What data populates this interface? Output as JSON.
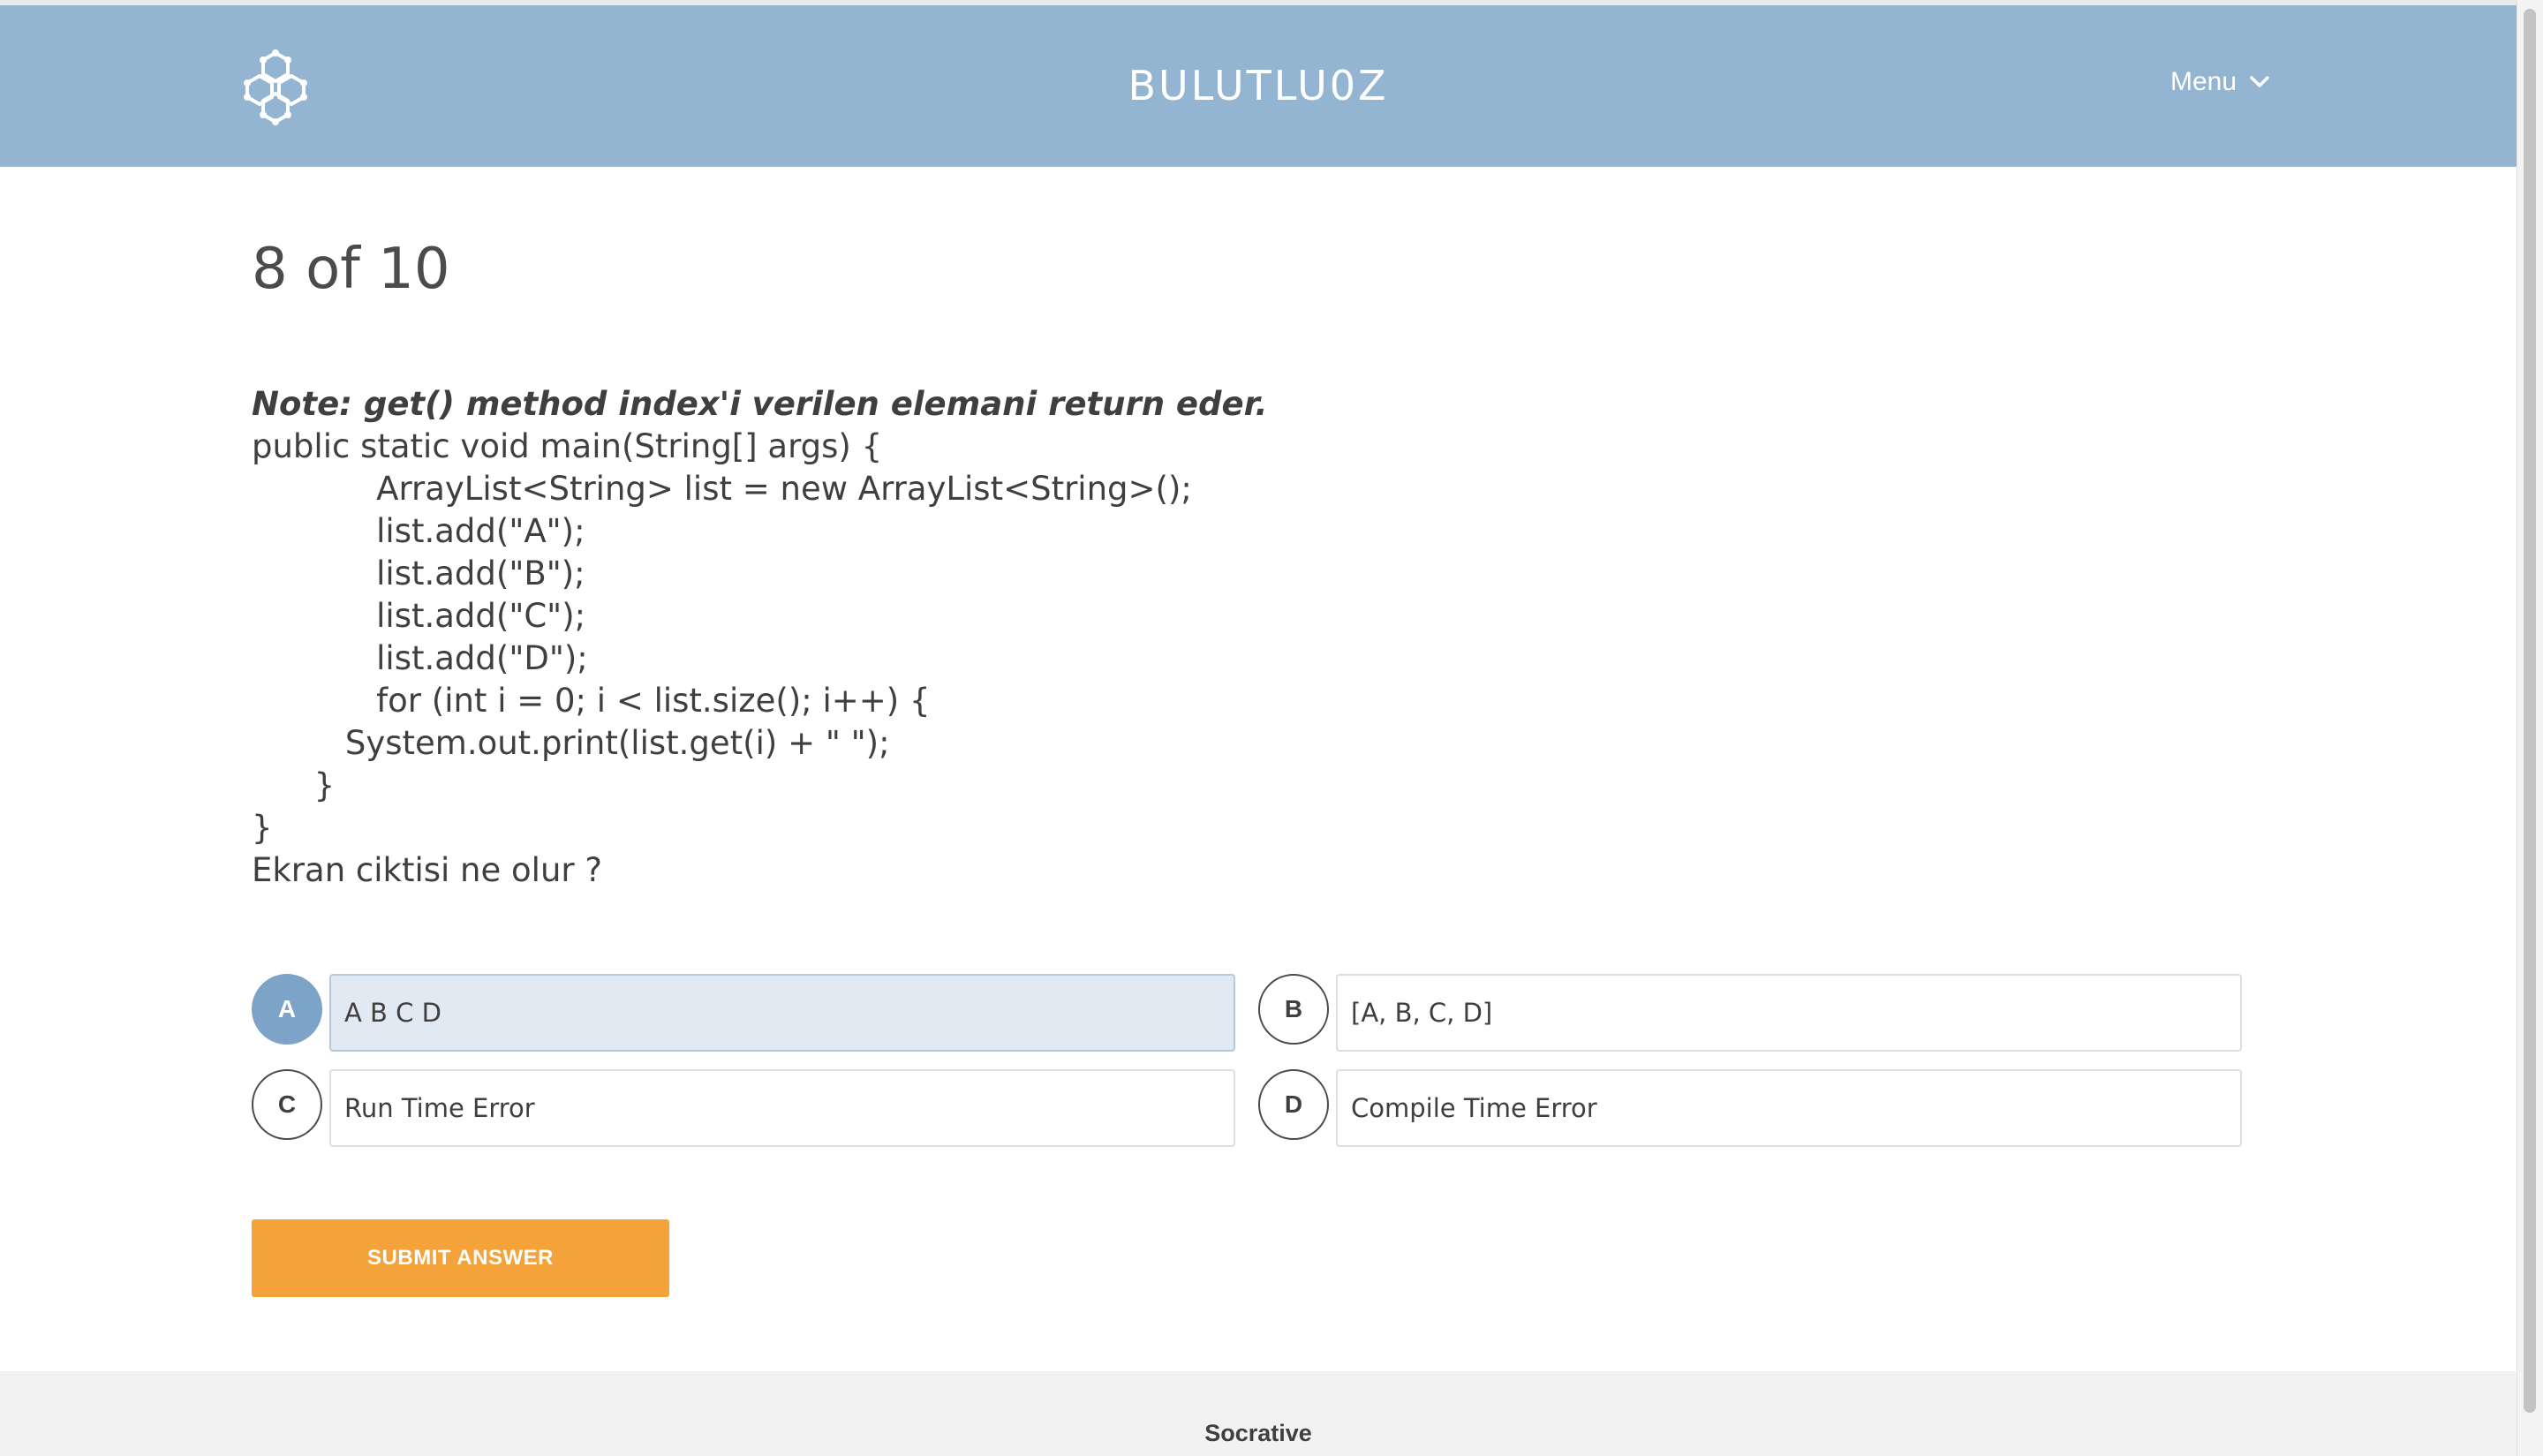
{
  "header": {
    "app_title": "BULUTLU0Z",
    "menu_label": "Menu",
    "logo_icon": "hexagon-cluster-logo-icon",
    "menu_icon": "chevron-down-icon",
    "background_color": "#94b5d1"
  },
  "quiz": {
    "progress": "8 of 10",
    "question_note": "Note: get() method index'i verilen elemani return eder.",
    "question_lines": [
      "public static void main(String[] args) {",
      "            ArrayList<String> list = new ArrayList<String>();",
      "            list.add(\"A\");",
      "            list.add(\"B\");",
      "            list.add(\"C\");",
      "            list.add(\"D\");",
      "            for (int i = 0; i < list.size(); i++) {",
      "         System.out.print(list.get(i) + \" \");",
      "      }",
      "}",
      "Ekran ciktisi ne olur ?"
    ],
    "answers": [
      {
        "letter": "A",
        "text": "A B C D",
        "selected": true
      },
      {
        "letter": "B",
        "text": "[A, B, C, D]",
        "selected": false
      },
      {
        "letter": "C",
        "text": "Run Time Error",
        "selected": false
      },
      {
        "letter": "D",
        "text": "Compile Time Error",
        "selected": false
      }
    ],
    "submit_label": "SUBMIT ANSWER",
    "selected_color": "#7ea3c8",
    "submit_color": "#f3a33a"
  },
  "footer": {
    "brand": "Socrative"
  }
}
